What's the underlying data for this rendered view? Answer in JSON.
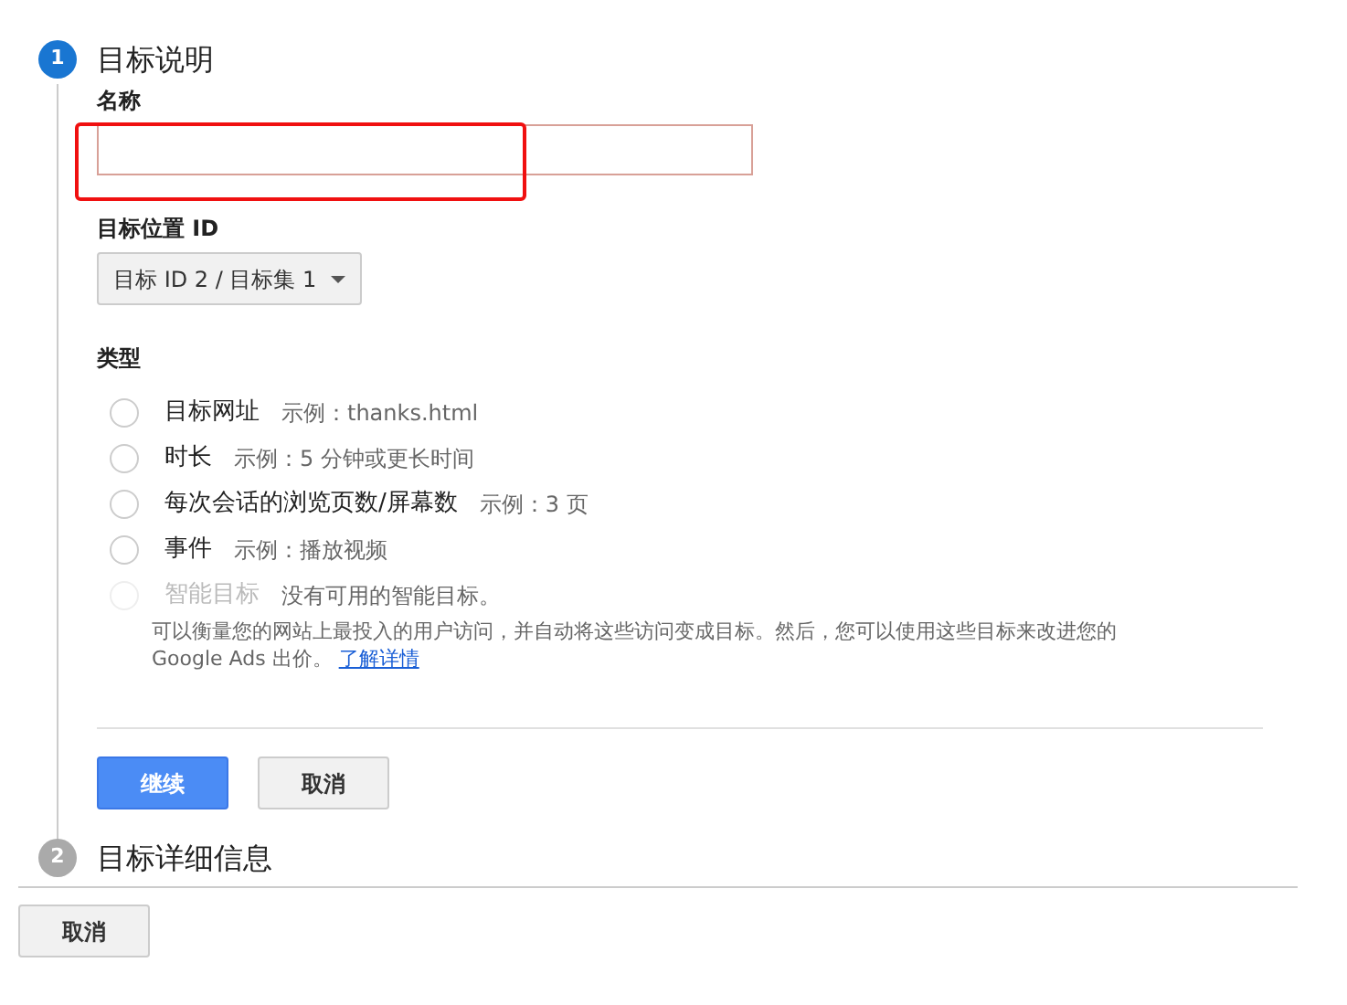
{
  "steps": [
    {
      "number": "1",
      "title": "目标说明",
      "active": true
    },
    {
      "number": "2",
      "title": "目标详细信息",
      "active": false
    }
  ],
  "name_field": {
    "label": "名称",
    "focused": true,
    "highlighted": true
  },
  "slot": {
    "label": "目标位置 ID",
    "value": "目标 ID 2 / 目标集 1"
  },
  "type": {
    "label": "类型",
    "options": [
      {
        "label": "目标网址",
        "example": "示例：thanks.html",
        "selected": false,
        "disabled": false
      },
      {
        "label": "时长",
        "example": "示例：5 分钟或更长时间",
        "selected": false,
        "disabled": false
      },
      {
        "label": "每次会话的浏览页数/屏幕数",
        "example": "示例：3 页",
        "selected": false,
        "disabled": false
      },
      {
        "label": "事件",
        "example": "示例：播放视频",
        "selected": false,
        "disabled": false
      },
      {
        "label": "智能目标",
        "example": "没有可用的智能目标。",
        "selected": false,
        "disabled": true
      }
    ],
    "description": "可以衡量您的网站上最投入的用户访问，并自动将这些访问变成目标。然后，您可以使用这些目标来改进您的 Google Ads 出价。",
    "link": "了解详情"
  },
  "buttons": [
    {
      "label": "继续",
      "primary": true
    },
    {
      "label": "取消",
      "primary": false
    }
  ],
  "footer_button": "取消"
}
